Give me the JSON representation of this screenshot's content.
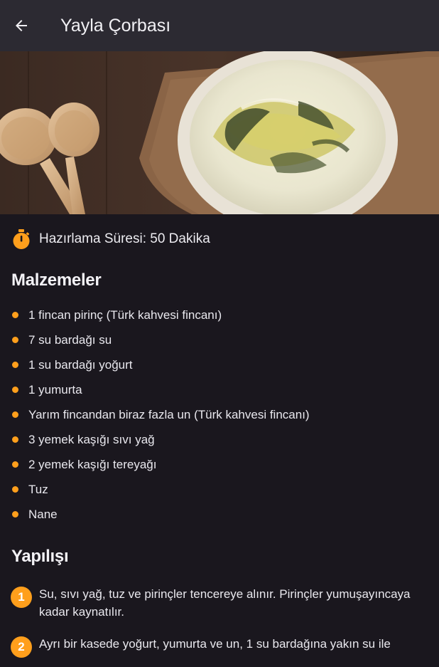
{
  "appbar": {
    "title": "Yayla Çorbası",
    "back_icon": "arrow-left-icon"
  },
  "hero": {
    "image": "yayla-soup-photo"
  },
  "prep": {
    "icon": "stopwatch-icon",
    "text": "Hazırlama Süresi: 50 Dakika"
  },
  "ingredients": {
    "title": "Malzemeler",
    "items": [
      "1 fincan pirinç (Türk kahvesi fincanı)",
      "7 su bardağı su",
      "1 su bardağı yoğurt",
      "1 yumurta",
      "Yarım fincandan biraz fazla un (Türk kahvesi fincanı)",
      "3 yemek kaşığı sıvı yağ",
      "2 yemek kaşığı tereyağı",
      "Tuz",
      "Nane"
    ]
  },
  "steps": {
    "title": "Yapılışı",
    "items": [
      {
        "num": "1",
        "text": "Su, sıvı yağ, tuz ve pirinçler tencereye alınır. Pirinçler yumuşayıncaya kadar kaynatılır."
      },
      {
        "num": "2",
        "text": "Ayrı bir kasede yoğurt, yumurta ve un, 1 su bardağına yakın su ile"
      }
    ]
  },
  "colors": {
    "accent": "#ff9f1c",
    "background": "#1a171e",
    "appbar": "#2c2a32"
  }
}
